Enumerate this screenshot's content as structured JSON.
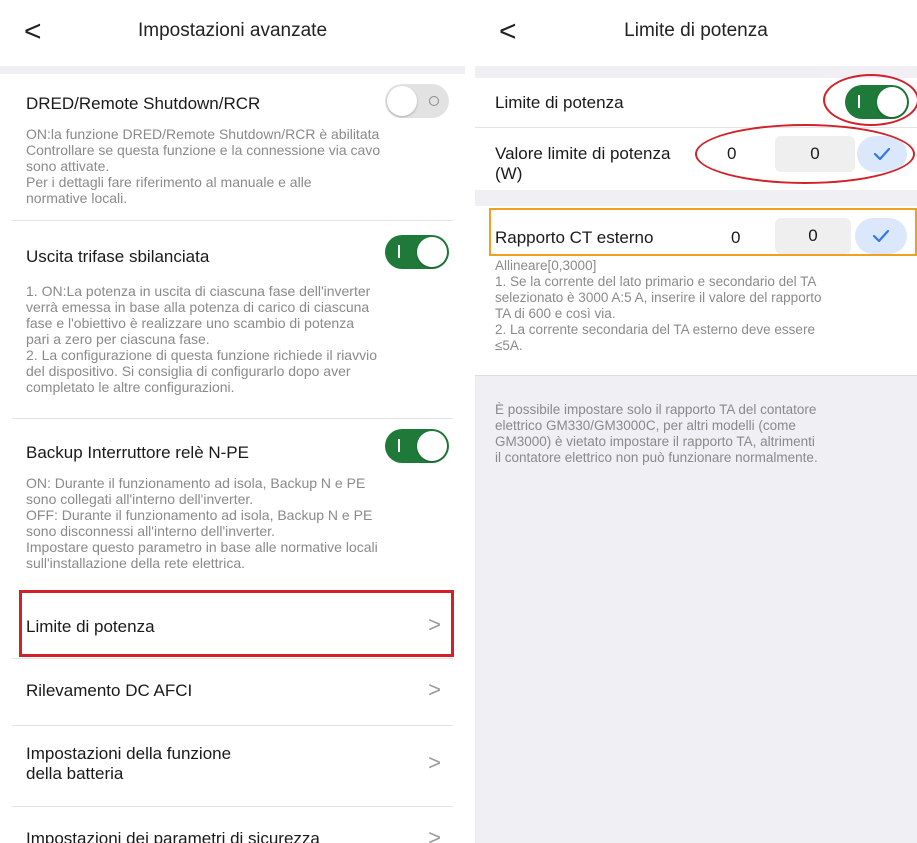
{
  "left": {
    "header": {
      "back_icon": "chevron-left-icon",
      "back_glyph": "<",
      "title": "Impostazioni avanzate"
    },
    "dred": {
      "title": "DRED/Remote Shutdown/RCR",
      "enabled": false,
      "desc": [
        "ON:la funzione DRED/Remote Shutdown/RCR è abilitata",
        "Controllare se questa funzione e la connessione via cavo",
        "sono attivate.",
        "Per i dettagli fare riferimento al manuale e alle",
        "normative locali."
      ]
    },
    "unbalanced": {
      "title": "Uscita trifase sbilanciata",
      "enabled": true,
      "desc": [
        "1. ON:La potenza in uscita di ciascuna fase dell'inverter",
        "verrà emessa in base alla potenza di carico di ciascuna",
        "fase e l'obiettivo è realizzare uno scambio di potenza",
        "pari a zero per ciascuna fase.",
        "2. La configurazione di questa funzione richiede il riavvio",
        "del dispositivo. Si consiglia di configurarlo dopo aver",
        "completato le altre configurazioni."
      ]
    },
    "backup_relay": {
      "title": "Backup Interruttore relè N-PE",
      "enabled": true,
      "desc": [
        "ON: Durante il funzionamento ad isola, Backup N e PE",
        "sono collegati all'interno dell'inverter.",
        "OFF: Durante il funzionamento ad isola, Backup N e PE",
        "sono disconnessi all'interno dell'inverter.",
        "Impostare questo parametro in base alle normative locali",
        "sull'installazione della rete elettrica."
      ]
    },
    "nav_items": [
      {
        "label": "Limite di potenza",
        "chevron": ">"
      },
      {
        "label": "Rilevamento DC AFCI",
        "chevron": ">"
      },
      {
        "label": "Impostazioni della funzione",
        "label2": "della batteria",
        "chevron": ">"
      },
      {
        "label": "Impostazioni dei parametri di sicurezza",
        "chevron": ">"
      }
    ]
  },
  "right": {
    "header": {
      "back_icon": "chevron-left-icon",
      "back_glyph": "<",
      "title": "Limite di potenza"
    },
    "power_limit": {
      "label": "Limite di potenza",
      "enabled": true
    },
    "power_value": {
      "label": "Valore limite di potenza",
      "label2": "(W)",
      "current": "0",
      "input_value": "0",
      "confirm_icon": "checkmark-icon"
    },
    "ct_ratio": {
      "label": "Rapporto CT esterno",
      "current": "0",
      "input_value": "0",
      "confirm_icon": "checkmark-icon",
      "desc": [
        "Allineare[0,3000]",
        "1. Se la corrente del lato primario e secondario del TA",
        "selezionato è 3000 A:5 A, inserire il valore del rapporto",
        "TA di 600 e così via.",
        "2. La corrente secondaria del TA esterno deve essere",
        "≤5A."
      ]
    },
    "note": [
      "È possibile impostare solo il rapporto TA del contatore",
      "elettrico GM330/GM3000C, per altri modelli (come",
      "GM3000) è vietato impostare il rapporto TA, altrimenti",
      "il contatore elettrico non può funzionare normalmente."
    ]
  },
  "colors": {
    "toggle_on": "#1f7a3a",
    "annotation_red": "#d1222a",
    "annotation_orange": "#f0a020",
    "check_blue": "#2f7ae6",
    "page_gray": "#efeff4"
  }
}
